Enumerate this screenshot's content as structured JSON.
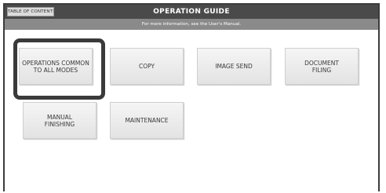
{
  "header": {
    "toc_label": "TABLE OF CONTENTS",
    "title": "OPERATION GUIDE",
    "subtitle": "For more information, see the User's Manual."
  },
  "modes": [
    {
      "label": "OPERATIONS COMMON\nTO ALL MODES",
      "highlighted": true
    },
    {
      "label": "COPY"
    },
    {
      "label": "IMAGE SEND"
    },
    {
      "label": "DOCUMENT\nFILING"
    },
    {
      "label": "MANUAL\nFINISHING"
    },
    {
      "label": "MAINTENANCE"
    }
  ],
  "colors": {
    "title_bar": "#4a4a4a",
    "sub_bar": "#8a8a8a",
    "highlight_border": "#3a3a3a"
  }
}
